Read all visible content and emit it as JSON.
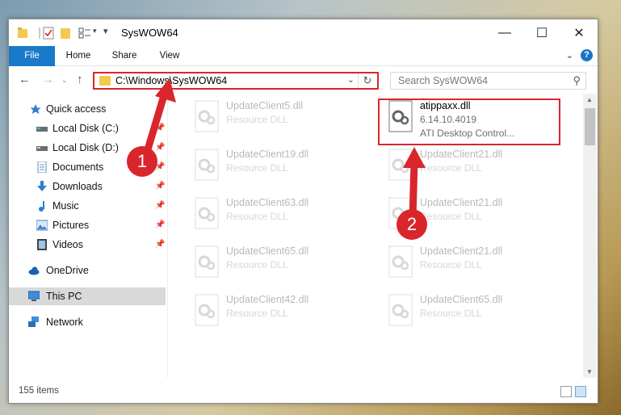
{
  "window": {
    "title": "SysWOW64",
    "buttons": {
      "minimize": "—",
      "maximize": "☐",
      "close": "✕"
    }
  },
  "ribbon": {
    "tabs": [
      "File",
      "Home",
      "Share",
      "View"
    ],
    "help_label": "?"
  },
  "address": {
    "path": "C:\\Windows\\SysWOW64",
    "search_placeholder": "Search SysWOW64"
  },
  "sidebar": {
    "items": [
      {
        "label": "Quick access",
        "icon": "star-icon",
        "pinned": false
      },
      {
        "label": "Local Disk (C:)",
        "icon": "drive-icon",
        "pinned": true
      },
      {
        "label": "Local Disk (D:)",
        "icon": "drive-icon",
        "pinned": true
      },
      {
        "label": "Documents",
        "icon": "documents-icon",
        "pinned": true
      },
      {
        "label": "Downloads",
        "icon": "download-icon",
        "pinned": true
      },
      {
        "label": "Music",
        "icon": "music-icon",
        "pinned": true
      },
      {
        "label": "Pictures",
        "icon": "pictures-icon",
        "pinned": true
      },
      {
        "label": "Videos",
        "icon": "videos-icon",
        "pinned": true
      },
      {
        "label": "OneDrive",
        "icon": "cloud-icon",
        "pinned": false
      },
      {
        "label": "This PC",
        "icon": "computer-icon",
        "pinned": false
      },
      {
        "label": "Network",
        "icon": "network-icon",
        "pinned": false
      }
    ]
  },
  "files": {
    "left": [
      {
        "name": "UpdateClient5.dll",
        "type": "Resource DLL"
      },
      {
        "name": "UpdateClient19.dll",
        "type": "Resource DLL"
      },
      {
        "name": "UpdateClient63.dll",
        "type": "Resource DLL"
      },
      {
        "name": "UpdateClient65.dll",
        "type": "Resource DLL"
      },
      {
        "name": "UpdateClient42.dll",
        "type": "Resource DLL"
      }
    ],
    "highlighted": {
      "name": "atippaxx.dll",
      "version": "6.14.10.4019",
      "description": "ATI Desktop Control..."
    },
    "right": [
      {
        "name": "UpdateClient21.dll",
        "type": "Resource DLL"
      },
      {
        "name": "UpdateClient21.dll",
        "type": "Resource DLL"
      },
      {
        "name": "UpdateClient21.dll",
        "type": "Resource DLL"
      },
      {
        "name": "UpdateClient65.dll",
        "type": "Resource DLL"
      }
    ]
  },
  "status": {
    "item_count": "155 items"
  },
  "annotations": {
    "step1": "1",
    "step2": "2",
    "color": "#d9262c"
  }
}
